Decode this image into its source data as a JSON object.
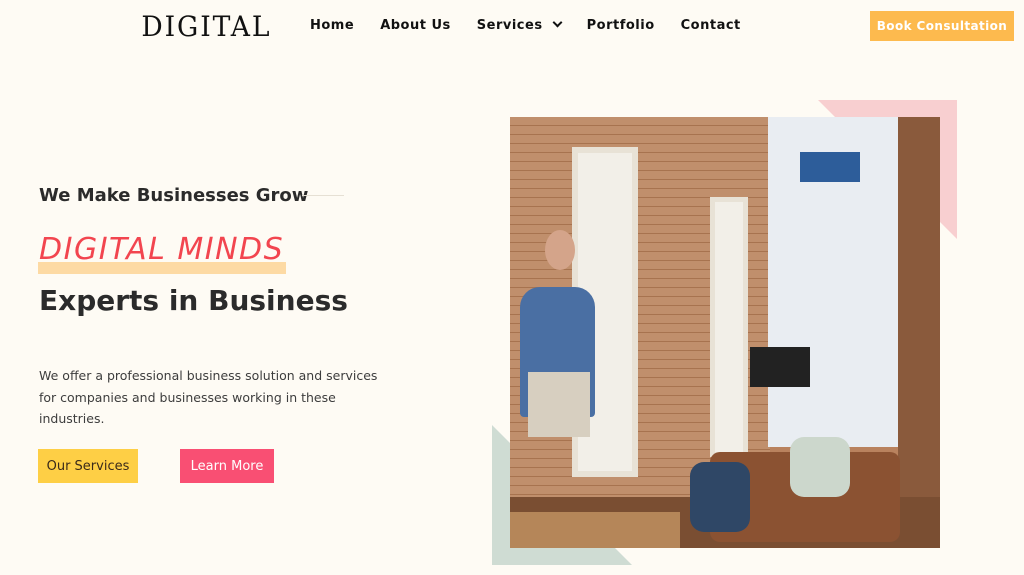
{
  "header": {
    "logo": "DIGITAL",
    "nav": [
      "Home",
      "About Us",
      "Services",
      "Portfolio",
      "Contact"
    ],
    "cta": "Book Consultation"
  },
  "hero": {
    "tagline": "We Make Businesses Grow",
    "highlight": "DIGITAL MINDS",
    "headline": "Experts in Business",
    "description": "We offer a professional business solution and services for companies and businesses working in these industries.",
    "primary_button": "Our Services",
    "secondary_button": "Learn More"
  },
  "colors": {
    "accent_orange": "#fdba4e",
    "accent_red": "#f2454f",
    "button_yellow": "#fecf45",
    "button_pink": "#f94f73"
  }
}
